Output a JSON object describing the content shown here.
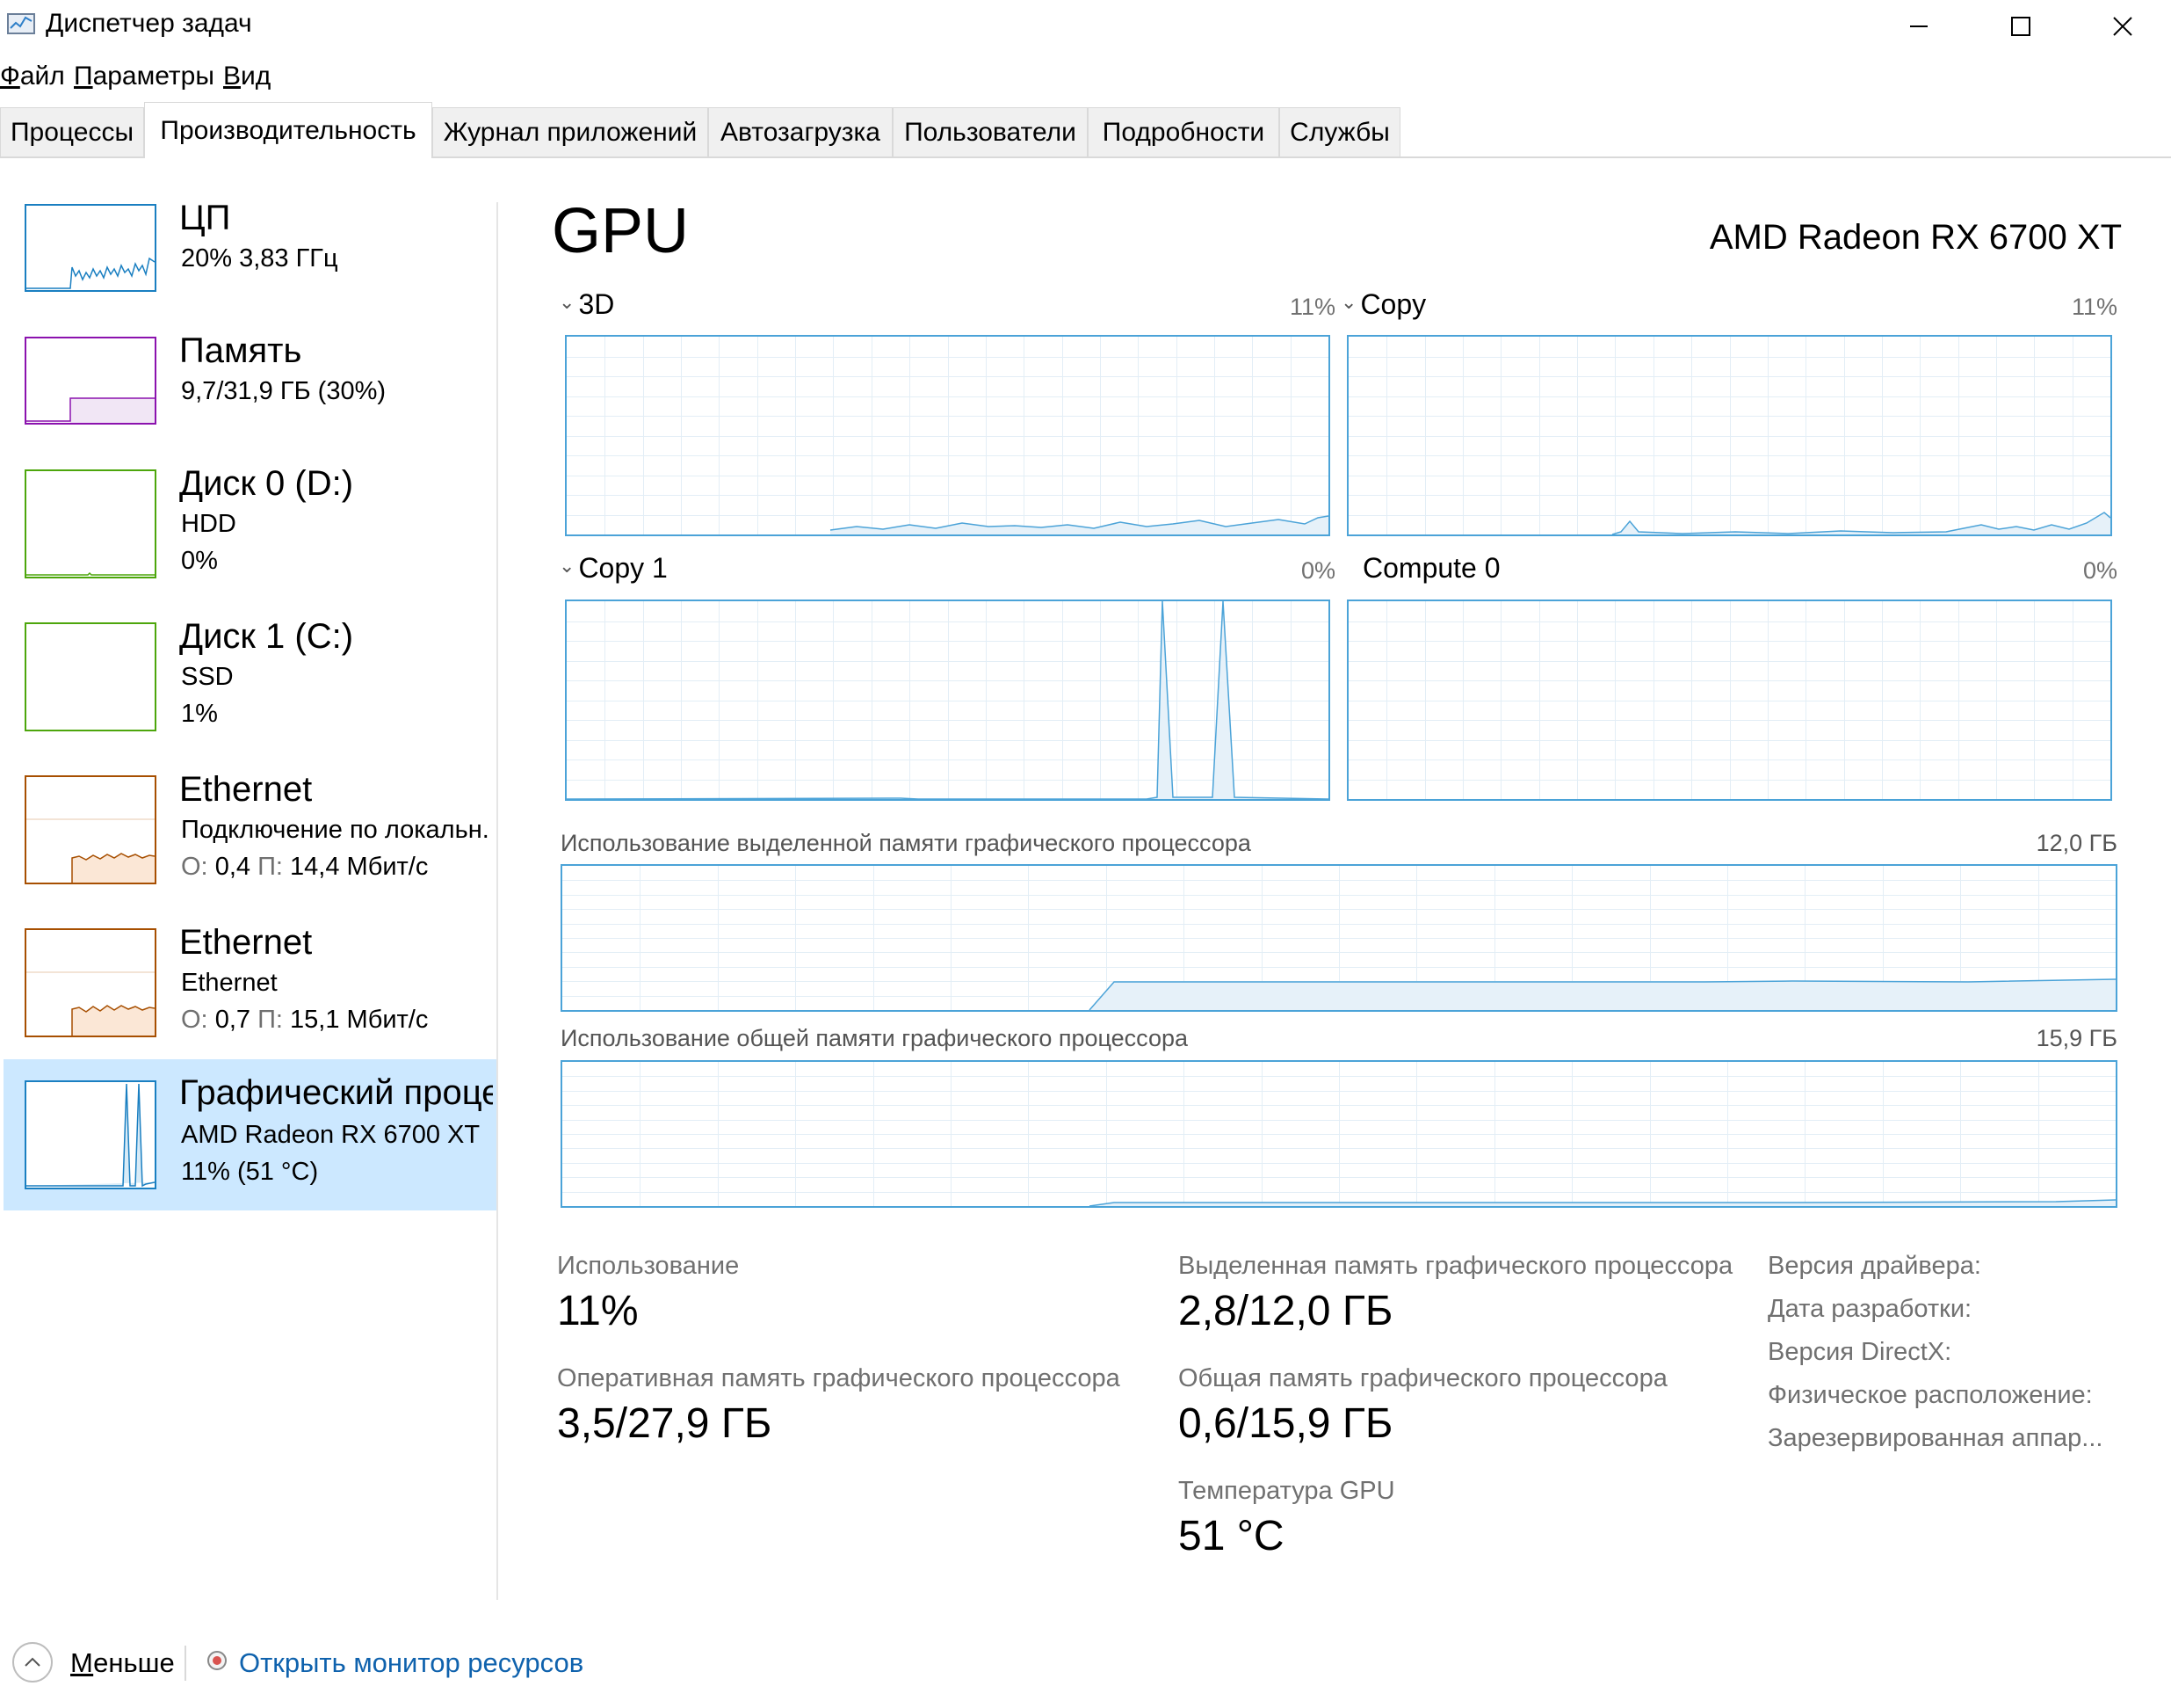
{
  "window": {
    "title": "Диспетчер задач",
    "minimize_symbol": "—",
    "maximize_symbol": "☐",
    "close_symbol": "✕"
  },
  "menu": {
    "file_first": "Ф",
    "file_rest": "айл",
    "params_first": "П",
    "params_rest": "араметры",
    "view_first": "В",
    "view_rest": "ид"
  },
  "tabs": [
    {
      "label": "Процессы"
    },
    {
      "label": "Производительность",
      "active": true
    },
    {
      "label": "Журнал приложений"
    },
    {
      "label": "Автозагрузка"
    },
    {
      "label": "Пользователи"
    },
    {
      "label": "Подробности"
    },
    {
      "label": "Службы"
    }
  ],
  "sidebar": {
    "cpu": {
      "title": "ЦП",
      "line1": "20%  3,83 ГГц"
    },
    "memory": {
      "title": "Память",
      "line1": "9,7/31,9 ГБ (30%)"
    },
    "disk0": {
      "title": "Диск 0 (D:)",
      "line1": "HDD",
      "line2": "0%"
    },
    "disk1": {
      "title": "Диск 1 (C:)",
      "line1": "SSD",
      "line2": "1%"
    },
    "eth1": {
      "title": "Ethernet",
      "line1": "Подключение по локальн.",
      "o_label": "О:",
      "o_value": "0,4",
      "p_label": "П:",
      "p_value": "14,4 Мбит/с"
    },
    "eth2": {
      "title": "Ethernet",
      "line1": "Ethernet",
      "o_label": "О:",
      "o_value": "0,7",
      "p_label": "П:",
      "p_value": "15,1 Мбит/с"
    },
    "gpu": {
      "title": "Графический проце",
      "line1": "AMD Radeon RX 6700 XT",
      "line2": "11%  (51 °C)"
    }
  },
  "main": {
    "title": "GPU",
    "device_name": "AMD Radeon RX 6700 XT",
    "engines": [
      {
        "name": "3D",
        "percent": "11%",
        "chevron": "⌄"
      },
      {
        "name": "Copy",
        "percent": "11%",
        "chevron": "⌄"
      },
      {
        "name": "Copy 1",
        "percent": "0%",
        "chevron": "⌄"
      },
      {
        "name": "Compute 0",
        "percent": "0%",
        "chevron": ""
      }
    ],
    "dedicated_graph": {
      "label": "Использование выделенной памяти графического процессора",
      "max": "12,0 ГБ"
    },
    "shared_graph": {
      "label": "Использование общей памяти графического процессора",
      "max": "15,9 ГБ"
    }
  },
  "stats": {
    "usage_label": "Использование",
    "usage_value": "11%",
    "dedicated_label": "Выделенная память графического процессора",
    "dedicated_value": "2,8/12,0 ГБ",
    "gpu_ram_label": "Оперативная память графического процессора",
    "gpu_ram_value": "3,5/27,9 ГБ",
    "shared_label": "Общая память графического процессора",
    "shared_value": "0,6/15,9 ГБ",
    "temp_label": "Температура GPU",
    "temp_value": "51 °C"
  },
  "info": {
    "driver_version": "Версия драйвера:",
    "driver_date": "Дата разработки:",
    "directx": "Версия DirectX:",
    "location": "Физическое расположение:",
    "reserved": "Зарезервированная аппар..."
  },
  "footer": {
    "less_first": "М",
    "less_rest": "еньше",
    "monitor_link": "Открыть монитор ресурсов"
  },
  "colors": {
    "cpu": "#1a7fc1",
    "memory": "#8b12ae",
    "disk": "#4da60c",
    "ethernet": "#a74f01",
    "gpu": "#1a7fc1",
    "selected": "#cce8ff",
    "link": "#0f62ad"
  },
  "icons": {
    "app": "task-manager-icon",
    "collapse": "chevron-up-icon",
    "resource_monitor": "resource-monitor-icon"
  }
}
